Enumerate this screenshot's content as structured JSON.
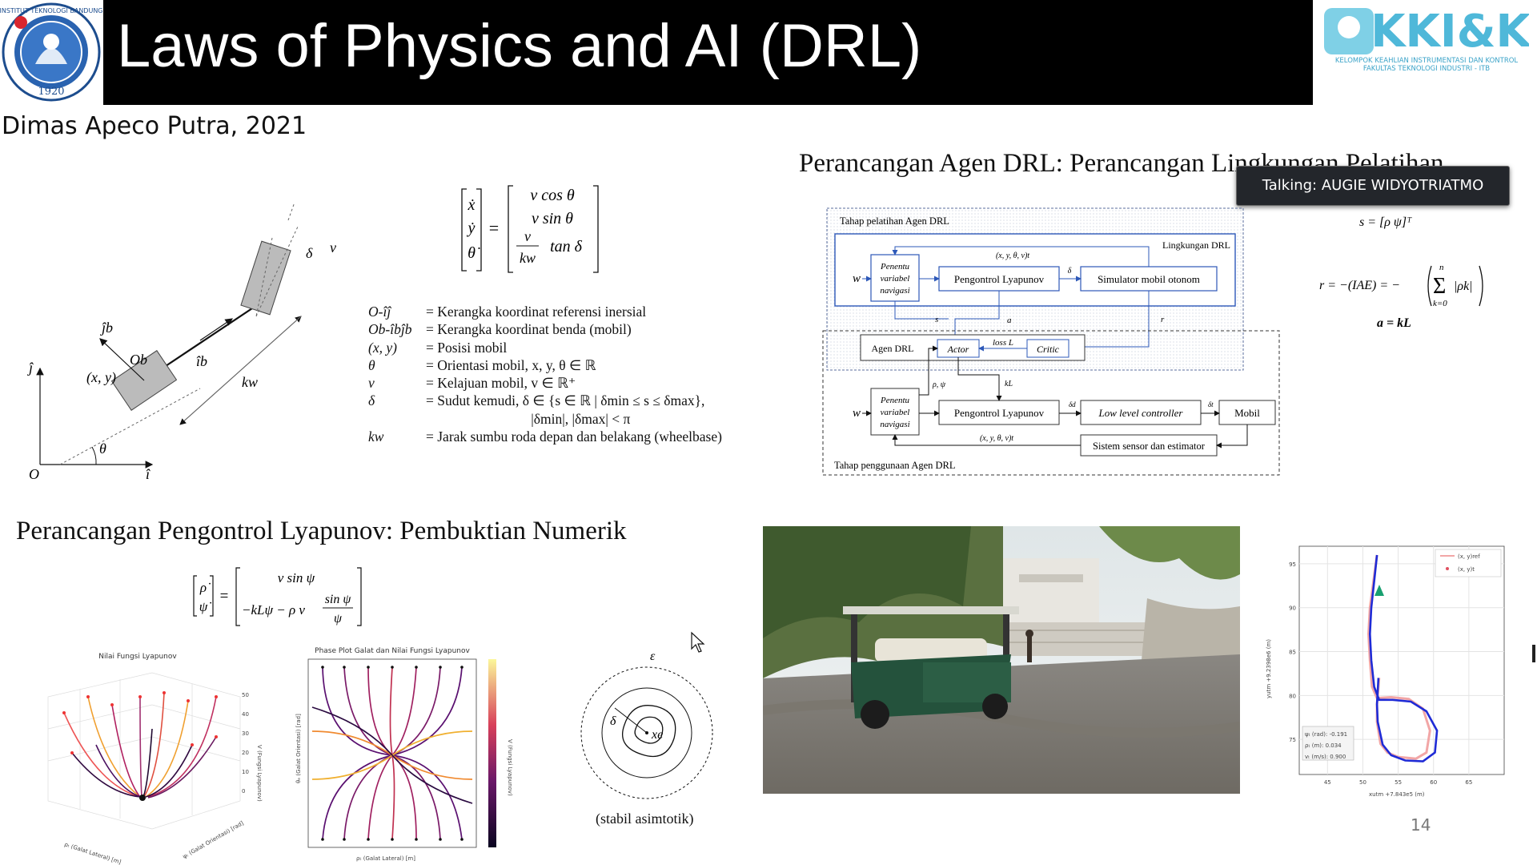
{
  "header": {
    "title": "Laws of Physics and AI (DRL)",
    "author": "Dimas Apeco Putra, 2021",
    "left_logo_text": "INSTITUT TEKNOLOGI BANDUNG",
    "left_logo_year": "1920",
    "right_logo_text": "KKI&K",
    "right_logo_caption_1": "KELOMPOK KEAHLIAN INSTRUMENTASI DAN KONTROL",
    "right_logo_caption_2": "FAKULTAS TEKNOLOGI INDUSTRI - ITB"
  },
  "meeting": {
    "talking": "Talking: AUGIE WIDYOTRIATMO"
  },
  "kinematics": {
    "labels": {
      "delta": "δ",
      "v": "v",
      "jb": "ĵb",
      "ob": "Ob",
      "ib": "îb",
      "xy": "(x, y)",
      "kw": "kw",
      "j": "ĵ",
      "theta": "θ",
      "o": "O",
      "i": "î"
    },
    "equation_rows": [
      "v cos θ",
      "v sin θ",
      "tan δ"
    ],
    "equation_lhs": [
      "ẋ",
      "ẏ",
      "θ̇"
    ],
    "equation_frac_num": "v",
    "equation_frac_den": "kw"
  },
  "definitions": [
    {
      "sym": "O-îĵ",
      "desc": "= Kerangka koordinat referensi inersial"
    },
    {
      "sym": "Ob-îbĵb",
      "desc": "= Kerangka koordinat benda (mobil)"
    },
    {
      "sym": "(x, y)",
      "desc": "= Posisi mobil"
    },
    {
      "sym": "θ",
      "desc": "= Orientasi mobil,   x, y, θ ∈ ℝ"
    },
    {
      "sym": "v",
      "desc": "= Kelajuan mobil,   v ∈ ℝ⁺"
    },
    {
      "sym": "δ",
      "desc": "= Sudut kemudi,     δ ∈ {s ∈ ℝ | δmin ≤ s ≤ δmax},"
    },
    {
      "sym": "",
      "desc": "                              |δmin|, |δmax| < π"
    },
    {
      "sym": "kw",
      "desc": "= Jarak sumbu roda depan dan belakang (wheelbase)"
    }
  ],
  "drl": {
    "title": "Perancangan Agen DRL: Perancangan Lingkungan Pelatihan",
    "training_label": "Tahap pelatihan Agen DRL",
    "env_label": "Lingkungan DRL",
    "deploy_label": "Tahap penggunaan Agen DRL",
    "w": "w",
    "nav_block": "Penentu variabel navigasi",
    "lyap_block": "Pengontrol Lyapunov",
    "sim_block": "Simulator mobil otonom",
    "agent_block": "Agen DRL",
    "actor_block": "Actor",
    "critic_block": "Critic",
    "loss_label": "loss L",
    "low_level_block": "Low level controller",
    "car_block": "Mobil",
    "sensor_block": "Sistem sensor dan estimator",
    "sig_xyt": "(x, y, θ, v)t",
    "sig_delta": "δ",
    "sig_s": "s",
    "sig_a": "a",
    "sig_r": "r",
    "sig_rho_psi": "ρ, ψ",
    "sig_kl": "kL",
    "sig_delta_d": "δd",
    "sig_delta_t": "δt",
    "state_eq": "s = [ρ   ψ]ᵀ",
    "reward_eq": "r = −(IAE) = −",
    "reward_sum": "|ρk|",
    "sum_upper": "n",
    "sum_lower": "k=0",
    "action_eq": "a = kL"
  },
  "lyapunov": {
    "title": "Perancangan Pengontrol Lyapunov: Pembuktian Numerik",
    "lhs": [
      "ρ̇",
      "ψ̇"
    ],
    "rhs_top": "v sin ψ",
    "rhs_bottom": "−kLψ − ρ v",
    "rhs_frac_num": "sin ψ",
    "rhs_frac_den": "ψ",
    "plot1_title": "Nilai Fungsi Lyapunov",
    "plot1_xlabel": "ρₜ (Galat Lateral) [m]",
    "plot1_ylabel": "ψₜ (Galat Orientasi) [rad]",
    "plot1_zlabel": "V (Fungsi Lyapunov)",
    "plot2_title": "Phase Plot Galat dan Nilai Fungsi Lyapunov",
    "plot2_xlabel": "ρₜ (Galat Lateral) [m]",
    "plot2_ylabel": "θₑ (Galat Orientasi) [rad]",
    "plot2_cbar_label": "V (Fungsi Lyapunov)",
    "stability_eps": "ε",
    "stability_delta": "δ",
    "stability_xe": "xe",
    "stability_caption": "(stabil asimtotik)"
  },
  "trajectory": {
    "legend": [
      "(x, y)ref",
      "(x, y)t"
    ],
    "ylabel": "yutm +9.2398e6 (m)",
    "xlabel": "xutm +7.843e5 (m)",
    "info": [
      "ψₜ (rad): -0.191",
      "ρₜ (m): 0.034",
      "vₜ (m/s): 0.900"
    ],
    "x_ticks": [
      "45",
      "50",
      "55",
      "60",
      "65"
    ],
    "y_ticks": [
      "75",
      "80",
      "85",
      "90",
      "95"
    ]
  },
  "chart_data": [
    {
      "type": "scatter",
      "title": "",
      "xlabel": "xutm +7.843e5 (m)",
      "ylabel": "yutm +9.2398e6 (m)",
      "xlim": [
        41,
        70
      ],
      "ylim": [
        71,
        97
      ],
      "series": [
        {
          "name": "(x, y)ref",
          "x": [
            52,
            51.5,
            51,
            50.8,
            51,
            51.3,
            52,
            54,
            56.5,
            58.5,
            59.5,
            59,
            57.5,
            55,
            53.5,
            52.5,
            52,
            52,
            52.3
          ],
          "y": [
            96,
            93,
            90,
            87,
            84,
            81,
            79.7,
            79.8,
            79.6,
            78.5,
            76,
            73.5,
            72.8,
            73,
            73.5,
            74.5,
            77,
            79,
            82
          ]
        },
        {
          "name": "(x, y)t",
          "x": [
            52,
            51.6,
            51.2,
            51,
            51.2,
            51.6,
            52.3,
            54.2,
            56.8,
            59,
            60.5,
            60.2,
            58.5,
            56,
            54,
            52.8,
            52.1,
            52,
            52.2
          ],
          "y": [
            96,
            93,
            90,
            87,
            84,
            81,
            79.5,
            79.5,
            79.3,
            78.2,
            76,
            73.5,
            72.5,
            72.6,
            73.2,
            74.4,
            77,
            79,
            82
          ]
        }
      ]
    }
  ],
  "slide_number": "14"
}
